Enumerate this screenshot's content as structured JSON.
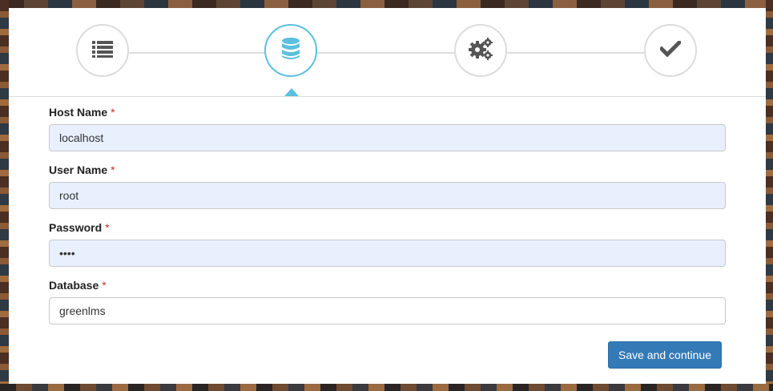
{
  "wizard": {
    "steps": [
      {
        "icon": "list-icon",
        "state": "complete"
      },
      {
        "icon": "database-icon",
        "state": "active"
      },
      {
        "icon": "cogs-icon",
        "state": "pending"
      },
      {
        "icon": "check-icon",
        "state": "pending"
      }
    ],
    "active_color": "#5bc0de"
  },
  "form": {
    "required_mark": "*",
    "host": {
      "label": "Host Name",
      "value": "localhost"
    },
    "user": {
      "label": "User Name",
      "value": "root"
    },
    "password": {
      "label": "Password",
      "value": "1234"
    },
    "database": {
      "label": "Database",
      "value": "greenlms"
    },
    "submit_label": "Save and continue"
  },
  "colors": {
    "primary_button": "#337ab7",
    "required": "#c9302c",
    "autofill_bg": "#e8f0fe"
  }
}
